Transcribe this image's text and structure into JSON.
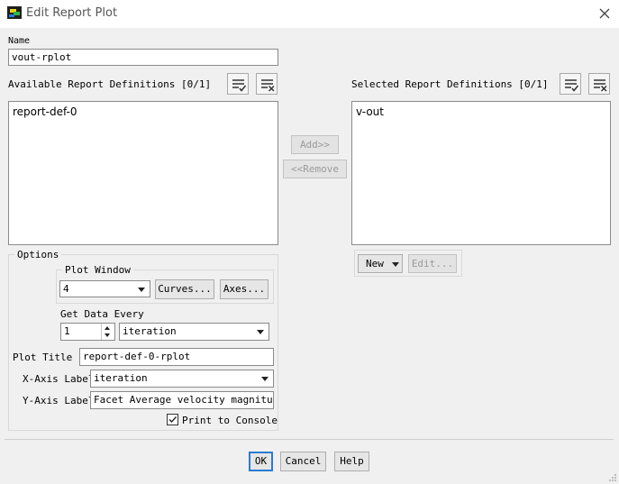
{
  "window": {
    "title": "Edit Report Plot",
    "close_icon": "close-icon"
  },
  "name": {
    "label": "Name",
    "value": "vout-rplot"
  },
  "available": {
    "label": "Available Report Definitions [0/1]",
    "items": [
      "report-def-0"
    ]
  },
  "selected": {
    "label": "Selected Report Definitions [0/1]",
    "items": [
      "v-out"
    ]
  },
  "transfer": {
    "add": "Add>>",
    "remove": "<<Remove"
  },
  "selected_actions": {
    "new": "New",
    "edit": "Edit..."
  },
  "options": {
    "label": "Options",
    "plot_window": {
      "label": "Plot Window",
      "value": "4",
      "curves": "Curves...",
      "axes": "Axes..."
    },
    "get_data_every": {
      "label": "Get Data Every",
      "count": "1",
      "unit": "iteration"
    },
    "plot_title": {
      "label": "Plot Title",
      "value": "report-def-0-rplot"
    },
    "x_axis": {
      "label": "X-Axis Label",
      "value": "iteration"
    },
    "y_axis": {
      "label": "Y-Axis Label",
      "value": "Facet Average velocity magnitude"
    },
    "print_to_console": {
      "label": "Print to Console",
      "checked": true
    }
  },
  "footer": {
    "ok": "OK",
    "cancel": "Cancel",
    "help": "Help"
  }
}
